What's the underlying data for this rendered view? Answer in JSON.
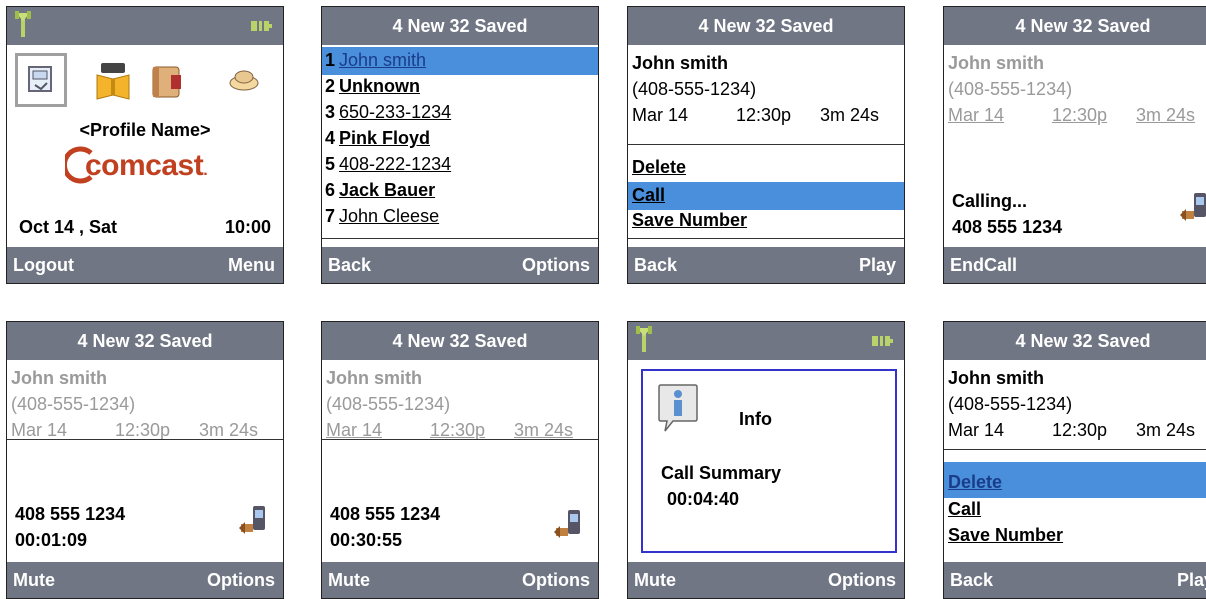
{
  "header_text": "4 New 32 Saved",
  "contact": {
    "name": "John smith",
    "number": "(408-555-1234)",
    "date": "Mar 14",
    "time": "12:30p",
    "duration": "3m 24s"
  },
  "screen1": {
    "profile_name": "<Profile Name>",
    "brand": "comcast",
    "brand_dot": ".",
    "date": "Oct 14 , Sat",
    "clock": "10:00",
    "softkey_left": "Logout",
    "softkey_right": "Menu",
    "icons": [
      "voicemail-icon",
      "phonebook-icon",
      "notebook-icon",
      "cloud-icon"
    ]
  },
  "screen2": {
    "list": [
      {
        "num": "1",
        "label": "John smith",
        "bold": false,
        "selected": true
      },
      {
        "num": "2",
        "label": "Unknown",
        "bold": true,
        "selected": false
      },
      {
        "num": "3",
        "label": "650-233-1234",
        "bold": false,
        "selected": false
      },
      {
        "num": "4",
        "label": "Pink Floyd",
        "bold": true,
        "selected": false
      },
      {
        "num": "5",
        "label": "408-222-1234",
        "bold": false,
        "selected": false
      },
      {
        "num": "6",
        "label": "Jack Bauer",
        "bold": true,
        "selected": false
      },
      {
        "num": "7",
        "label": "John Cleese",
        "bold": false,
        "selected": false
      }
    ],
    "softkey_left": "Back",
    "softkey_right": "Options"
  },
  "menu": {
    "delete": "Delete",
    "call": "Call",
    "save_number": "Save Number"
  },
  "screen3": {
    "softkey_left": "Back",
    "softkey_right": "Play",
    "selected": "call"
  },
  "screen4": {
    "status": "Calling...",
    "number": "408 555 1234",
    "softkey_left": "EndCall"
  },
  "screen5": {
    "number": "408 555 1234",
    "timer": "00:01:09",
    "softkey_left": "Mute",
    "softkey_right": "Options"
  },
  "screen6": {
    "number": "408 555 1234",
    "timer": "00:30:55",
    "softkey_left": "Mute",
    "softkey_right": "Options"
  },
  "screen7": {
    "title": "Info",
    "summary_label": "Call Summary",
    "summary_time": "00:04:40",
    "softkey_left": "Mute",
    "softkey_right": "Options"
  },
  "screen8": {
    "softkey_left": "Back",
    "softkey_right": "Play",
    "selected": "delete"
  },
  "colors": {
    "bar": "#707684",
    "highlight": "#4a8fdb",
    "dialog_border": "#3333cc"
  }
}
